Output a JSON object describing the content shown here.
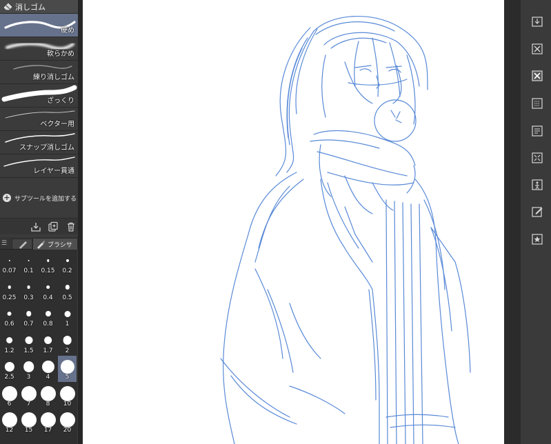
{
  "subtool_panel": {
    "title": "消しゴム",
    "brushes": [
      {
        "label": "硬め",
        "selected": true
      },
      {
        "label": "軟らかめ",
        "selected": false
      },
      {
        "label": "練り消しゴム",
        "selected": false
      },
      {
        "label": "ざっくり",
        "selected": false
      },
      {
        "label": "ベクター用",
        "selected": false
      },
      {
        "label": "スナップ消しゴム",
        "selected": false
      },
      {
        "label": "レイヤー貫通",
        "selected": false
      }
    ],
    "add_subtool_label": "サブツールを追加する"
  },
  "toolbar_icons": [
    "import-icon",
    "duplicate-icon",
    "trash-icon"
  ],
  "tabs": {
    "menu_icon": "☰",
    "active_label": "ブラシサ"
  },
  "brush_sizes": {
    "values": [
      "0.07",
      "0.1",
      "0.15",
      "0.2",
      "0.25",
      "0.3",
      "0.4",
      "0.5",
      "0.6",
      "0.7",
      "0.8",
      "1",
      "1.2",
      "1.5",
      "1.7",
      "2",
      "2.5",
      "3",
      "4",
      "5",
      "6",
      "7",
      "8",
      "10",
      "12",
      "15",
      "17",
      "20"
    ],
    "selected": "5"
  },
  "command_bar": {
    "buttons": [
      "import-image-icon",
      "clear-layer-icon",
      "clear-outside-selection-icon",
      "fill-icon",
      "new-layer-icon",
      "transform-icon",
      "scale-icon",
      "edit-icon",
      "favorite-icon"
    ]
  },
  "colors": {
    "panel_bg": "#3b3b3b",
    "selection": "#66728c",
    "sketch_line": "#4a7fd4",
    "canvas": "#ffffff"
  }
}
